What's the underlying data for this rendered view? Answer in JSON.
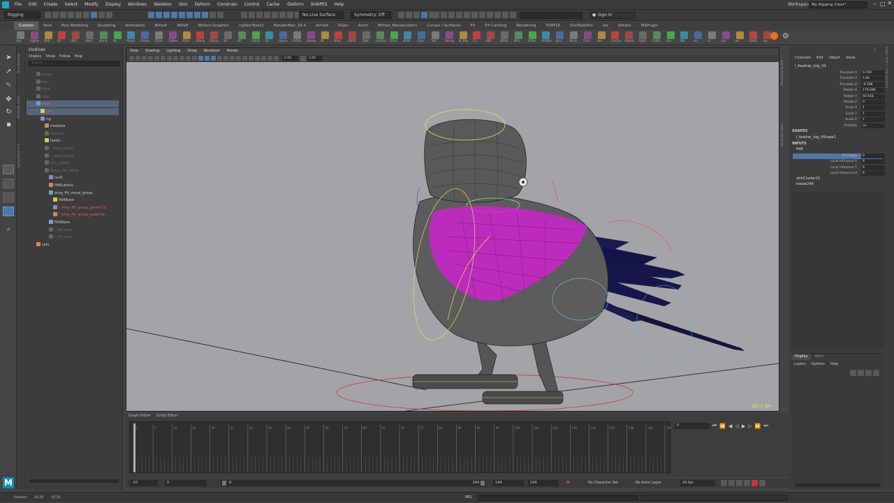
{
  "menubar": {
    "items": [
      "File",
      "Edit",
      "Create",
      "Select",
      "Modify",
      "Display",
      "Windows",
      "Skeleton",
      "Skin",
      "Deform",
      "Constrain",
      "Control",
      "Cache",
      "rDeform",
      "SHAPES",
      "Help"
    ],
    "workspace_label": "Workspace:",
    "workspace_value": "My Rigging Clear*"
  },
  "statusline": {
    "menuset": "Rigging",
    "live_surface": "No Live Surface",
    "symmetry": "Symmetry: Off",
    "sign_in": "Sign In"
  },
  "shelf": {
    "tabs": [
      "Custom",
      "face",
      "Poly Modeling",
      "Sculpting",
      "Animation",
      "Bifrost",
      "MASH",
      "Motion Graphics",
      "ngSkinTools2",
      "RenderMan_24.4",
      "Arnold",
      "XGen",
      "Anim",
      "Bifrost_Manipulators",
      "Curves / Surfaces",
      "FX",
      "FX Caching",
      "Rendering",
      "TURTLE",
      "ZooToolsPro",
      "lex",
      "Omoto",
      "MSPlugin"
    ],
    "active_tab": "Custom",
    "buttons": [
      "Sep",
      "RigPan",
      "RLW",
      "R5",
      "BS2",
      "Ideal",
      "Blend",
      "Per",
      "PlanA",
      "Pickup",
      "CSkin",
      "CyMen",
      "RSkin",
      "RSkng",
      "RSkng",
      "2V",
      "SP",
      "CopyS",
      "SH",
      "House",
      "PxTool",
      "Skelap",
      "SB",
      "Bind",
      "SSOff",
      "TgSk",
      "GeoOut",
      "TrOut",
      "HSW",
      "Color",
      "TrdL",
      "Facing",
      "M_Bltg",
      "1.1",
      "BSE",
      "BSRst",
      "Mrfs",
      "RrRes",
      "PrOffse",
      "Sym",
      "Mirror",
      "Time",
      "Sen",
      "CorOut",
      "ShStds",
      "FlpBS",
      "FlpBS",
      "Sep",
      "RIN",
      "sel",
      "in",
      "par",
      "sel",
      "FlpBS",
      "ray"
    ]
  },
  "outliner": {
    "title": "Outliner",
    "menu": [
      "Display",
      "Show",
      "Follow",
      "Help"
    ],
    "search_placeholder": "Search...",
    "rows": [
      {
        "label": "persp",
        "indent": 1,
        "dim": true
      },
      {
        "label": "top",
        "indent": 1,
        "dim": true
      },
      {
        "label": "front",
        "indent": 1,
        "dim": true
      },
      {
        "label": "side",
        "indent": 1,
        "dim": true
      },
      {
        "label": "main",
        "indent": 1,
        "sel": true,
        "red": true
      },
      {
        "label": "geo",
        "indent": 2,
        "sel": true,
        "red": true
      },
      {
        "label": "rig",
        "indent": 2
      },
      {
        "label": "modules",
        "indent": 3
      },
      {
        "label": "rotation",
        "indent": 3,
        "dim": true
      },
      {
        "label": "twists",
        "indent": 3
      },
      {
        "label": "l_wing_twing",
        "indent": 3,
        "dim": true
      },
      {
        "label": "r_wing_twing",
        "indent": 3,
        "dim": true
      },
      {
        "label": "fun_system",
        "indent": 3,
        "dim": true
      },
      {
        "label": "wings_ffd_group",
        "indent": 3,
        "dim": true
      },
      {
        "label": "null1",
        "indent": 4
      },
      {
        "label": "ffd4Lattice",
        "indent": 4
      },
      {
        "label": "wing_ffd_move_group",
        "indent": 4
      },
      {
        "label": "ffd4Base",
        "indent": 5
      },
      {
        "label": "l_wing_ffd_group_parentCo",
        "indent": 5,
        "red": true
      },
      {
        "label": "l_wing_ffd_group_scaleCon",
        "indent": 5,
        "red": true
      },
      {
        "label": "ffd5Base",
        "indent": 4
      },
      {
        "label": "l_fld_base",
        "indent": 4,
        "dim": true
      },
      {
        "label": "r_fld_base",
        "indent": 4,
        "dim": true
      },
      {
        "label": "sets",
        "indent": 1
      }
    ]
  },
  "viewport": {
    "menu": [
      "View",
      "Shading",
      "Lighting",
      "Show",
      "Renderer",
      "Panels"
    ],
    "field1": "0.00",
    "field2": "1.00",
    "fps_label": "187.5 fps"
  },
  "channelbox": {
    "menu": [
      "Channels",
      "Edit",
      "Object",
      "Show"
    ],
    "object": "l_feather_big_01",
    "attributes": [
      {
        "name": "Translate X",
        "value": "0.769"
      },
      {
        "name": "Translate Y",
        "value": "1.84"
      },
      {
        "name": "Translate Z",
        "value": "-0.398"
      },
      {
        "name": "Rotate X",
        "value": "176.696"
      },
      {
        "name": "Rotate Y",
        "value": "92.918"
      },
      {
        "name": "Rotate Z",
        "value": "0"
      },
      {
        "name": "Scale X",
        "value": "1"
      },
      {
        "name": "Scale Y",
        "value": "1"
      },
      {
        "name": "Scale Z",
        "value": "1"
      },
      {
        "name": "Visibility",
        "value": "on"
      }
    ],
    "shapes_header": "SHAPES",
    "shape": "l_feather_big_0Shape1",
    "inputs_header": "INPUTS",
    "input": "ffd4",
    "input_attrs": [
      {
        "name": "Envelope",
        "value": "0",
        "sel": true
      },
      {
        "name": "Local Influence S",
        "value": "6"
      },
      {
        "name": "Local Influence T",
        "value": "6"
      },
      {
        "name": "Local Influence U",
        "value": "6"
      }
    ],
    "other_inputs": [
      "skinCluster15",
      "tweak248"
    ],
    "vtabs": [
      "Channel Box / Layer Editor",
      "Modeling Toolkit",
      "Attribute Editor"
    ]
  },
  "layers": {
    "tabs": [
      "Display",
      "Anim"
    ],
    "menu": [
      "Layers",
      "Options",
      "Help"
    ]
  },
  "timebar": {
    "tabs": [
      "Graph Editor",
      "Script Editor"
    ],
    "current_frame": "0",
    "ticks": [
      "0",
      "5",
      "10",
      "15",
      "20",
      "25",
      "30",
      "35",
      "40",
      "45",
      "50",
      "55",
      "60",
      "65",
      "70",
      "75",
      "80",
      "85",
      "90",
      "95",
      "100",
      "105",
      "110",
      "115",
      "120",
      "125",
      "130",
      "135",
      "140"
    ]
  },
  "range": {
    "start": "-10",
    "min": "0",
    "slider_start": "0",
    "slider_end": "144",
    "max": "144",
    "end": "144",
    "character_set": "No Character Set",
    "anim_layer": "No Anim Layer",
    "fps": "24 fps"
  },
  "helpline": {
    "label": "Rotation:",
    "value1": "-42.00",
    "value2": "-45.30",
    "lang": "MEL"
  },
  "colors": {
    "selection": "#d010d0",
    "feathers": "#1a1a50",
    "viewport_bg": "#a4a4a8",
    "active_tab": "#5d5d5d",
    "highlight": "#4e78a8"
  }
}
